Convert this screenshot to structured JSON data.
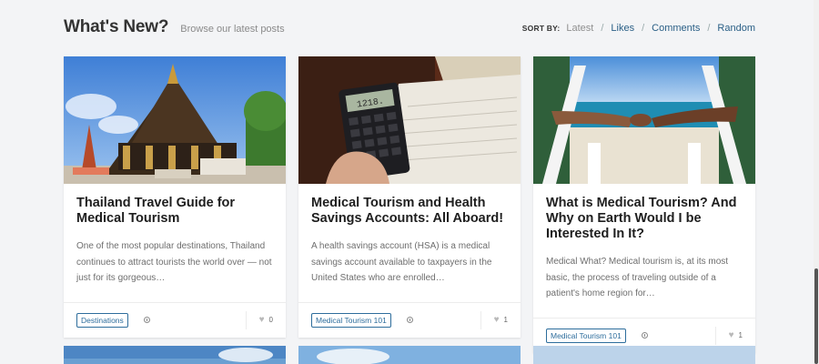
{
  "header": {
    "title": "What's New?",
    "subtitle": "Browse our latest posts",
    "sort_label": "SORT BY:",
    "sort_options": [
      "Latest",
      "Likes",
      "Comments",
      "Random"
    ],
    "sort_active": "Latest"
  },
  "posts": [
    {
      "title": "Thailand Travel Guide for Medical Tourism",
      "excerpt": "One of the most popular destinations, Thailand continues to attract tourists the world over — not just for its gorgeous…",
      "tag": "Destinations",
      "likes": "0"
    },
    {
      "title": "Medical Tourism and Health Savings Accounts: All Aboard!",
      "excerpt": "A health savings account (HSA) is a medical savings account available to taxpayers in the United States who are enrolled…",
      "tag": "Medical Tourism 101",
      "likes": "1",
      "calc_display": "1218."
    },
    {
      "title": "What is Medical Tourism? And Why on Earth Would I be Interested In It?",
      "excerpt": "Medical What? Medical tourism is, at its most basic, the process of traveling outside of a patient's home region for…",
      "tag": "Medical Tourism 101",
      "likes": "1"
    }
  ],
  "icons": {
    "clock": "clock-icon",
    "heart": "heart-icon"
  },
  "colors": {
    "link": "#2a5f86",
    "tag_border": "#2d6d9c",
    "background": "#f3f4f6"
  }
}
